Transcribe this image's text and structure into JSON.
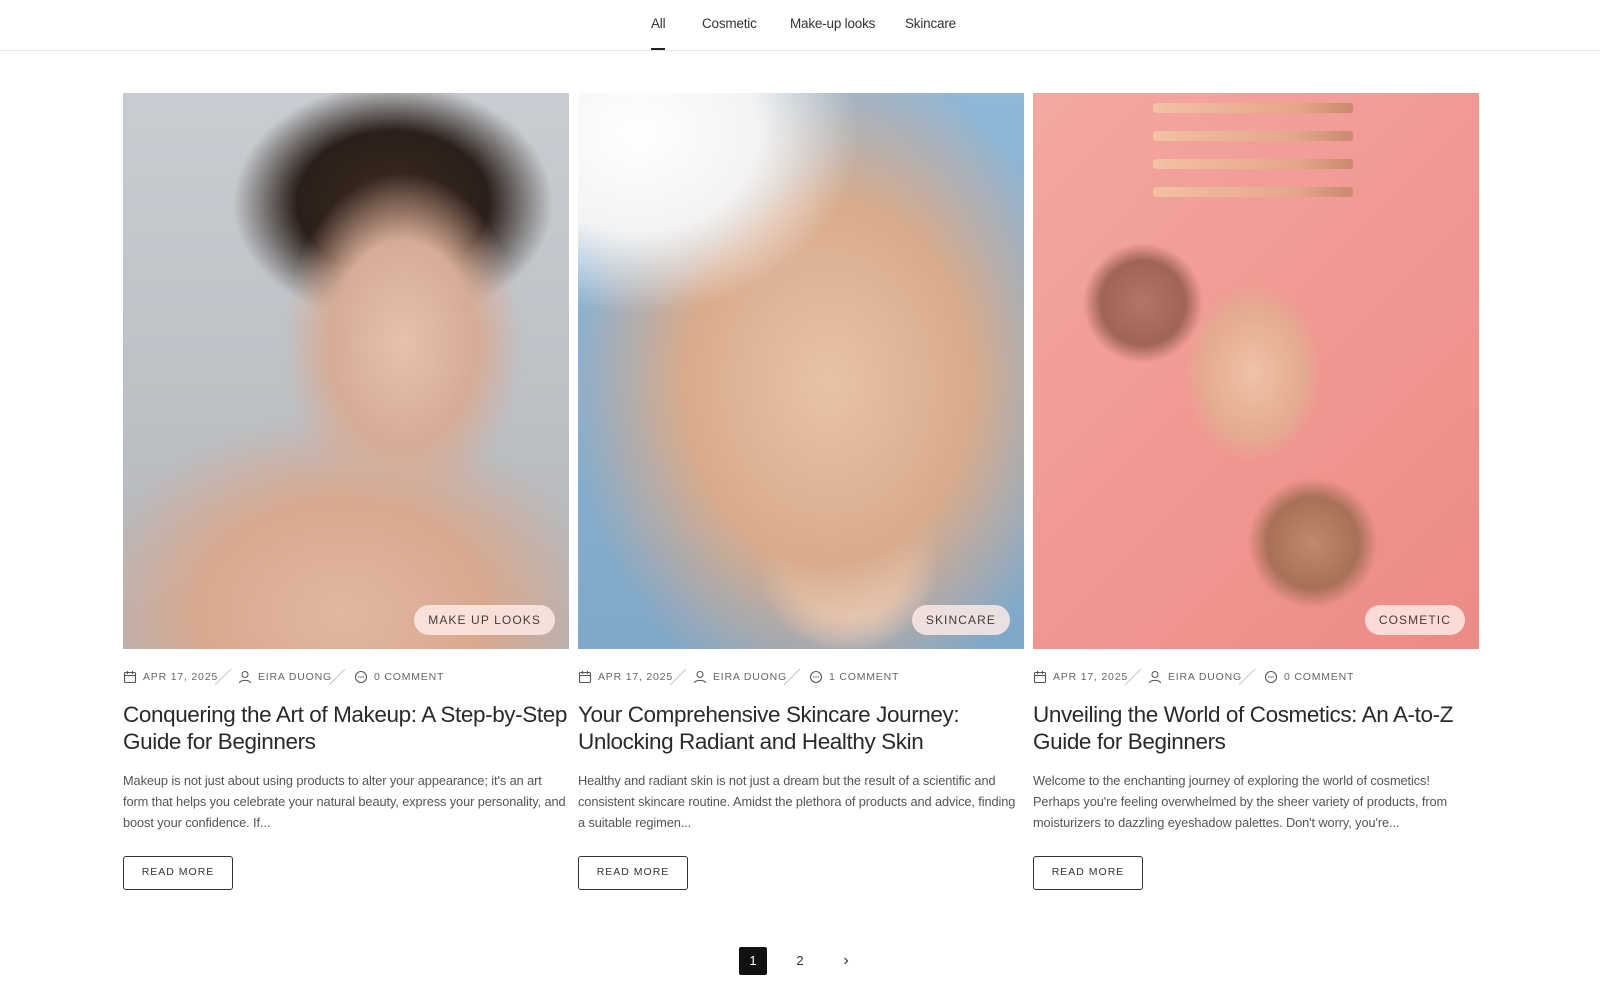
{
  "filters": {
    "tabs": [
      {
        "label": "All"
      },
      {
        "label": "Cosmetic"
      },
      {
        "label": "Make-up looks"
      },
      {
        "label": "Skincare"
      }
    ],
    "active": "All"
  },
  "posts": [
    {
      "category": "MAKE UP LOOKS",
      "date": "APR 17, 2025",
      "author": "EIRA DUONG",
      "comments": "0 COMMENT",
      "title": "Conquering the Art of Makeup: A Step-by-Step Guide for Beginners",
      "excerpt": "Makeup is not just about using products to alter your appearance; it's an art form that helps you celebrate your natural beauty, express your personality, and boost your confidence. If...",
      "read_more": "READ MORE"
    },
    {
      "category": "SKINCARE",
      "date": "APR 17, 2025",
      "author": "EIRA DUONG",
      "comments": "1 COMMENT",
      "title": "Your Comprehensive Skincare Journey: Unlocking Radiant and Healthy Skin",
      "excerpt": "Healthy and radiant skin is not just a dream but the result of a scientific and consistent skincare routine. Amidst the plethora of products and advice, finding a suitable regimen...",
      "read_more": "READ MORE"
    },
    {
      "category": "COSMETIC",
      "date": "APR 17, 2025",
      "author": "EIRA DUONG",
      "comments": "0 COMMENT",
      "title": "Unveiling the World of Cosmetics: An A-to-Z Guide for Beginners",
      "excerpt": "Welcome to the enchanting journey of exploring the world of cosmetics! Perhaps you're feeling overwhelmed by the sheer variety of products, from moisturizers to dazzling eyeshadow palettes. Don't worry, you're...",
      "read_more": "READ MORE"
    }
  ],
  "pagination": {
    "pages": [
      "1",
      "2"
    ],
    "current": "1",
    "next_icon": "chevron-right-icon",
    "next_glyph": "›"
  },
  "icons": {
    "date": "calendar-icon",
    "author": "user-icon",
    "comments": "comment-icon"
  },
  "colors": {
    "accent": "#111111",
    "badge_bg": "#ffece8",
    "text": "#2a2a2a"
  }
}
